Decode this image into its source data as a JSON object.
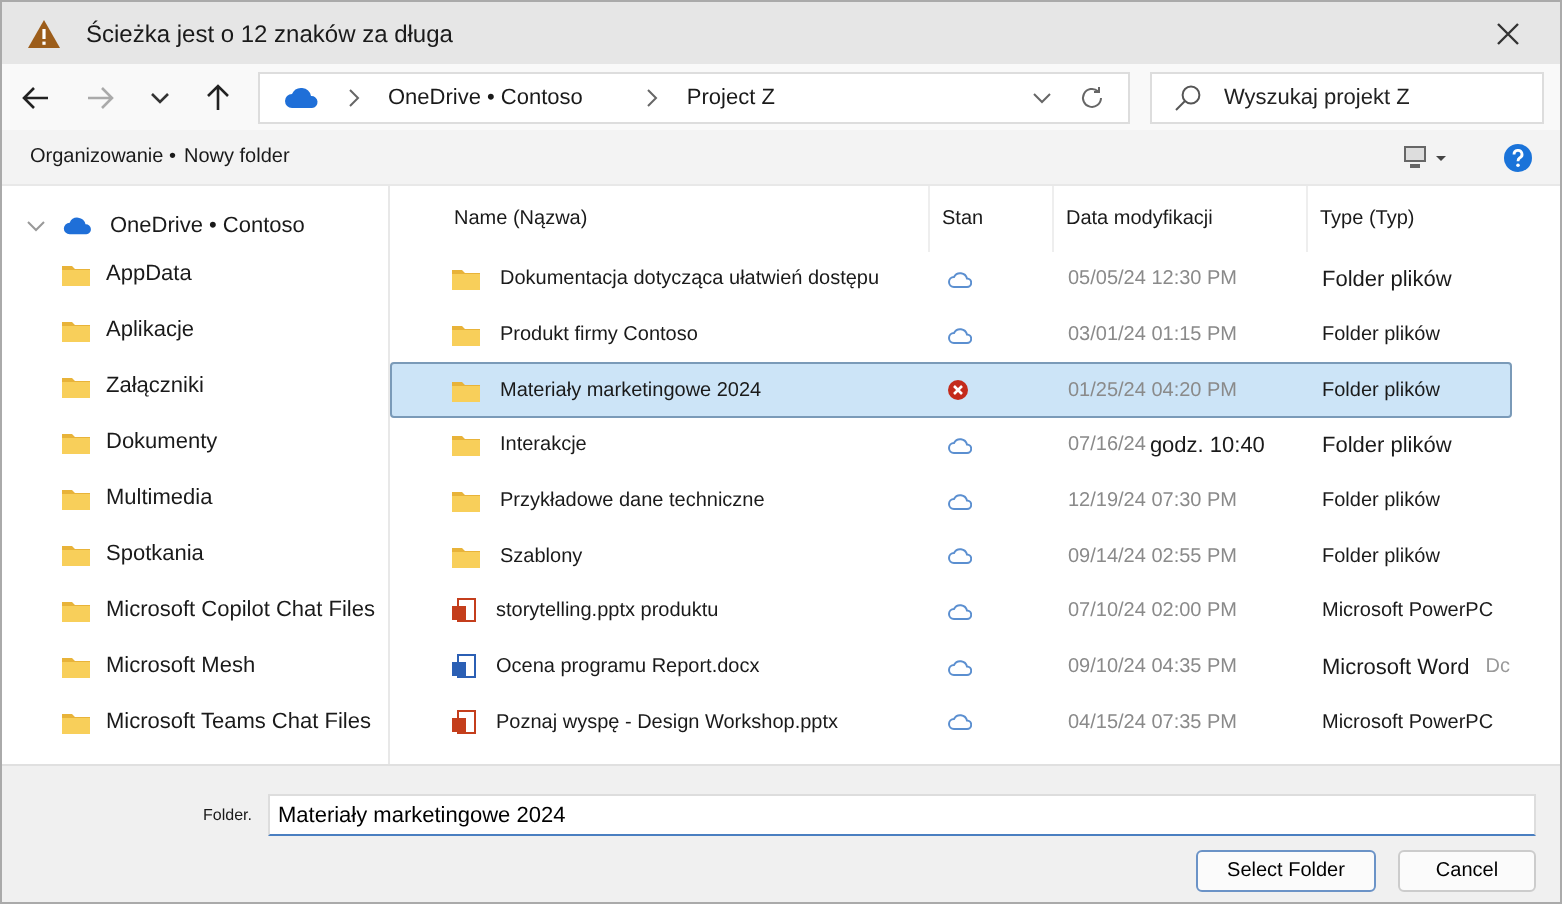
{
  "window": {
    "title": "Ścieżka jest o 12 znaków za długa"
  },
  "address": {
    "segments": [
      "OneDrive • Contoso",
      "Project Z"
    ]
  },
  "search": {
    "placeholder": "Wyszukaj projekt Z"
  },
  "toolbar": {
    "items": [
      "Organizowanie •",
      "Nowy folder"
    ]
  },
  "sidebar": {
    "items": [
      {
        "label": "OneDrive • Contoso",
        "kind": "cloud",
        "expanded": true,
        "children": [
          {
            "label": "AppData"
          },
          {
            "label": "Aplikacje"
          },
          {
            "label": "Załączniki"
          },
          {
            "label": "Dokumenty"
          },
          {
            "label": "Multimedia"
          },
          {
            "label": "Spotkania"
          },
          {
            "label": "Microsoft Copilot Chat Files"
          },
          {
            "label": "Microsoft Mesh"
          },
          {
            "label": "Microsoft Teams Chat Files"
          }
        ]
      }
    ]
  },
  "table": {
    "columns": [
      "Name (Nązwa)",
      "Stan",
      "Data modyfikacji",
      "Type (Typ)"
    ],
    "rows": [
      {
        "name": "Dokumentacja dotycząca ułatwień dostępu",
        "kind": "folder",
        "sync_error": false,
        "date": "05/05/24 12:30 PM",
        "type": "Folder plików",
        "selected": false
      },
      {
        "name": "Produkt firmy Contoso",
        "kind": "folder",
        "sync_error": false,
        "date": "03/01/24 01:15 PM",
        "type": "Folder plików",
        "selected": false
      },
      {
        "name": "Materiały marketingowe 2024",
        "kind": "folder",
        "sync_error": true,
        "date": "01/25/24 04:20 PM",
        "type": "Folder plików",
        "selected": true
      },
      {
        "name": "Interakcje",
        "kind": "folder",
        "sync_error": false,
        "date": "07/16/24",
        "date_extra": "godz. 10:40",
        "type": "Folder plików",
        "selected": false
      },
      {
        "name": "Przykładowe dane techniczne",
        "kind": "folder",
        "sync_error": false,
        "date": "12/19/24 07:30 PM",
        "type": "Folder plików",
        "selected": false
      },
      {
        "name": "Szablony",
        "kind": "folder",
        "sync_error": false,
        "date": "09/14/24 02:55 PM",
        "type": "Folder plików",
        "selected": false
      },
      {
        "name": "storytelling.pptx produktu",
        "kind": "pptx",
        "sync_error": false,
        "date": "07/10/24 02:00 PM",
        "type": "Microsoft PowerPC",
        "selected": false
      },
      {
        "name": "Ocena programu Report.docx",
        "kind": "docx",
        "sync_error": false,
        "date": "09/10/24 04:35 PM",
        "type": "Microsoft Word",
        "type_extra": "Dc",
        "selected": false
      },
      {
        "name": "Poznaj wyspę - Design Workshop.pptx",
        "kind": "pptx",
        "sync_error": false,
        "date": "04/15/24 07:35 PM",
        "type": "Microsoft PowerPC",
        "selected": false
      }
    ]
  },
  "folder_field": {
    "label": "Folder.",
    "value": "Materiały marketingowe 2024"
  },
  "buttons": [
    "Select Folder",
    "Cancel"
  ]
}
